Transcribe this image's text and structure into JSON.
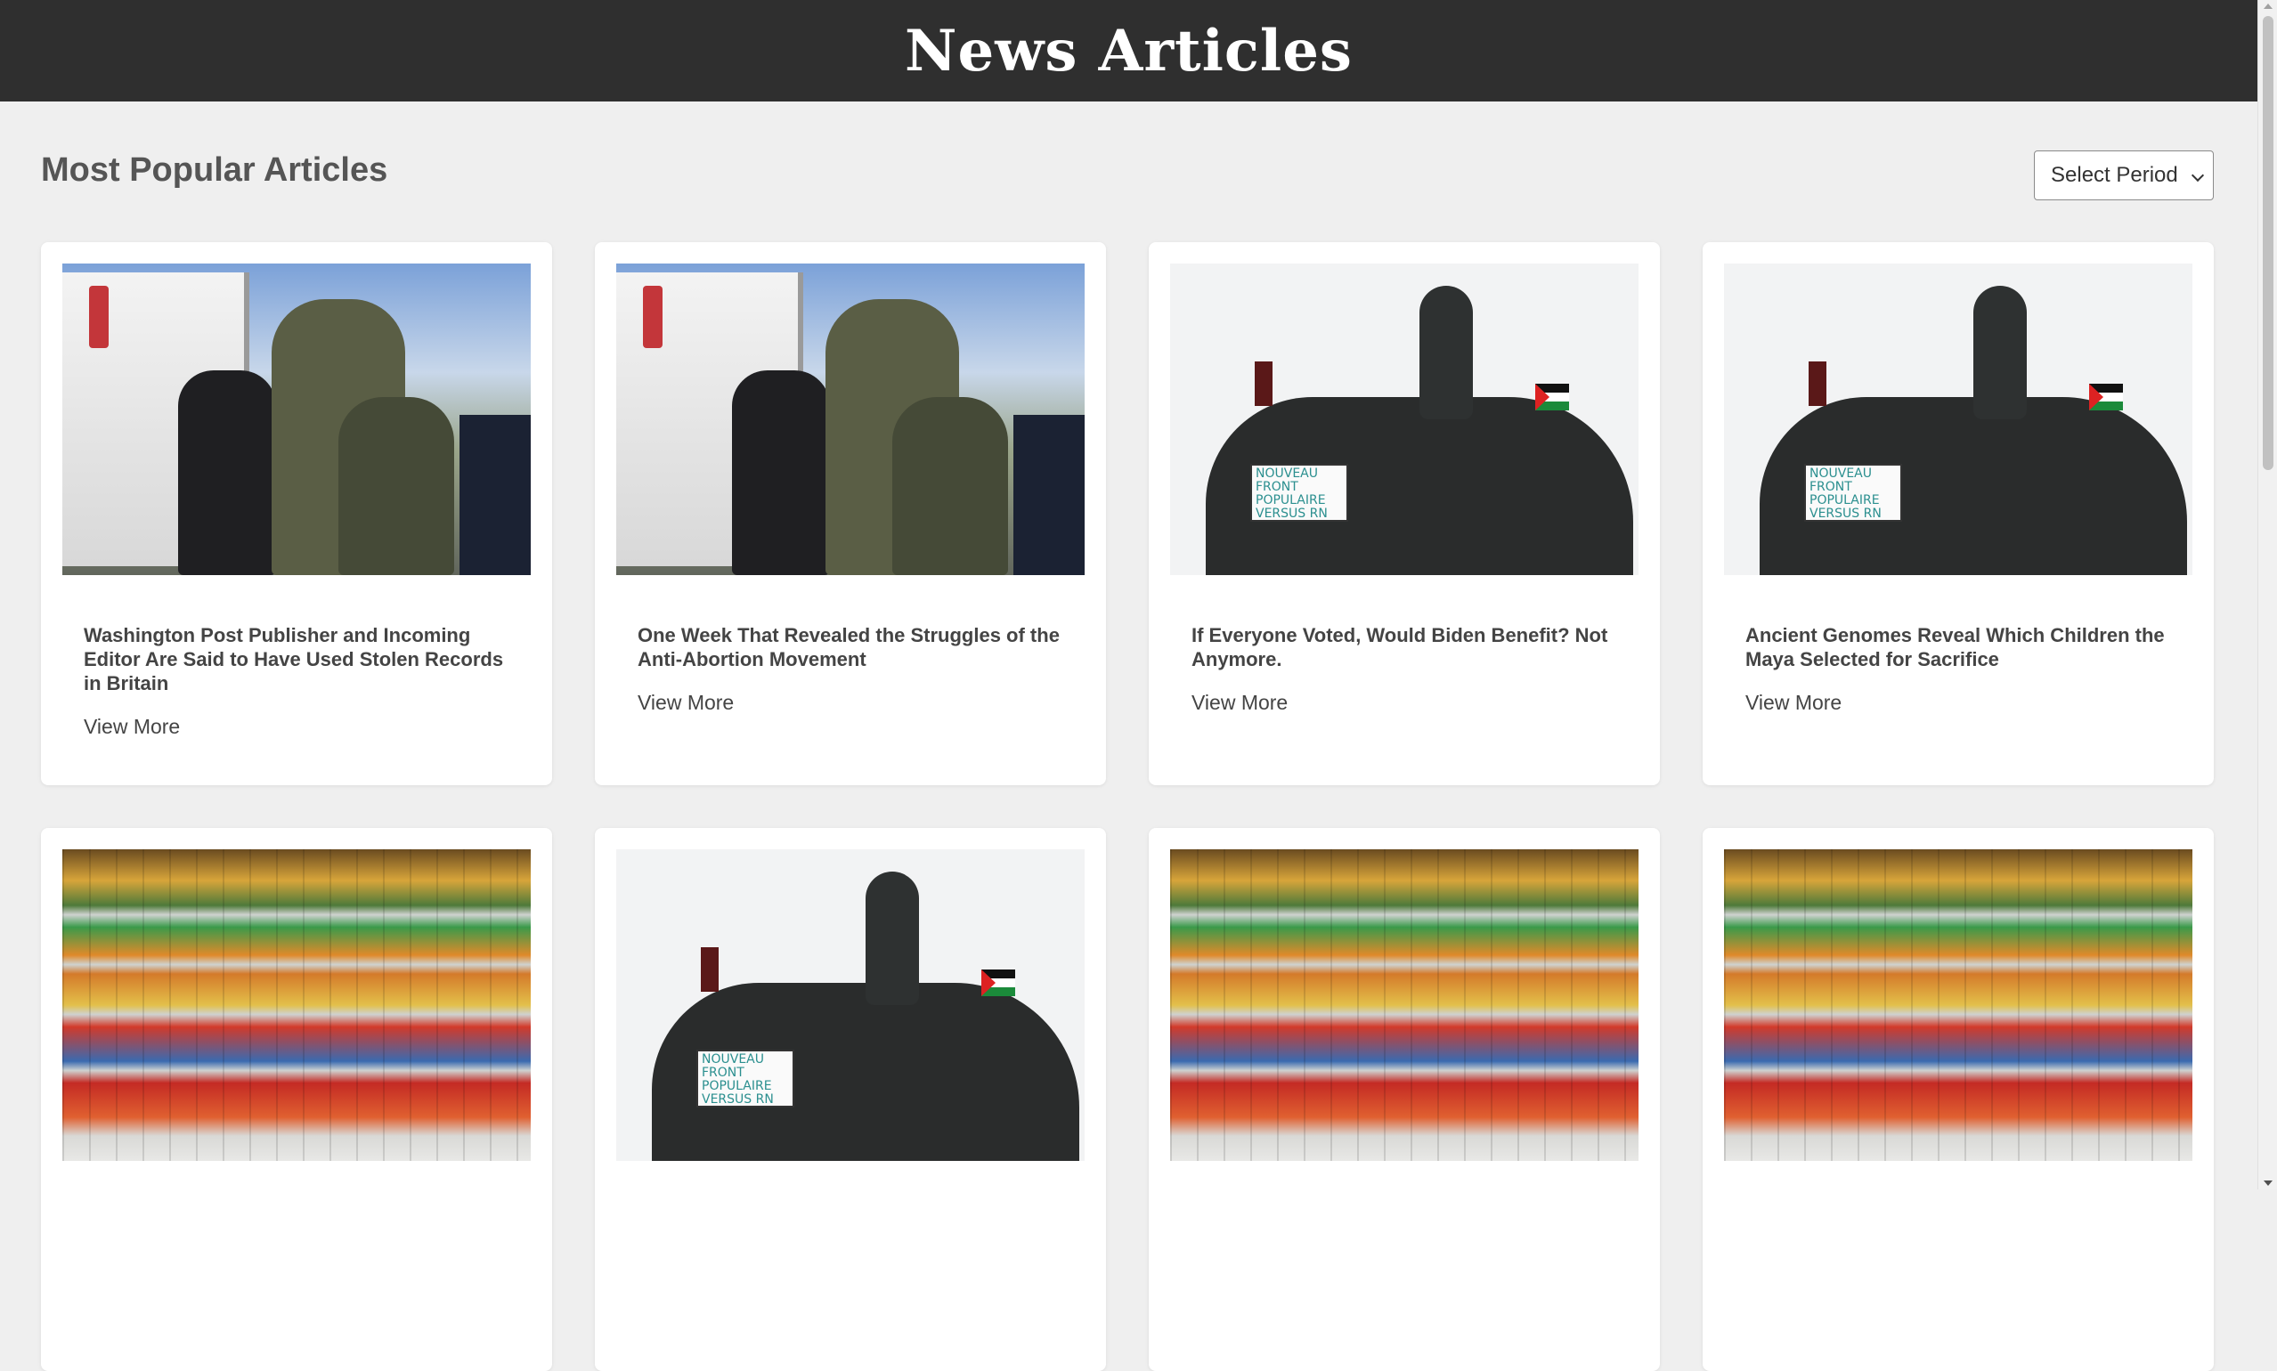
{
  "header": {
    "site_title": "News Articles"
  },
  "main": {
    "section_title": "Most Popular Articles",
    "period_select": {
      "selected": "Select Period"
    }
  },
  "articles": [
    {
      "title": "Washington Post Publisher and Incoming Editor Are Said to Have Used Stolen Records in Britain",
      "link_label": "View More",
      "image": "border-patrol-arrest"
    },
    {
      "title": "One Week That Revealed the Struggles of the Anti-Abortion Movement",
      "link_label": "View More",
      "image": "border-patrol-arrest"
    },
    {
      "title": "If Everyone Voted, Would Biden Benefit? Not Anymore.",
      "link_label": "View More",
      "image": "statue-protest"
    },
    {
      "title": "Ancient Genomes Reveal Which Children the Maya Selected for Sacrifice",
      "link_label": "View More",
      "image": "statue-protest"
    },
    {
      "title": "",
      "link_label": "",
      "image": "grocery-shelves"
    },
    {
      "title": "",
      "link_label": "",
      "image": "statue-protest"
    },
    {
      "title": "",
      "link_label": "",
      "image": "grocery-shelves"
    },
    {
      "title": "",
      "link_label": "",
      "image": "grocery-shelves"
    }
  ],
  "image_text": {
    "protest_sign": "NOUVEAU FRONT POPULAIRE VERSUS RN"
  },
  "colors": {
    "header_bg": "#2f2f2f",
    "page_bg": "#efefef",
    "card_bg": "#ffffff",
    "heading": "#555555"
  }
}
